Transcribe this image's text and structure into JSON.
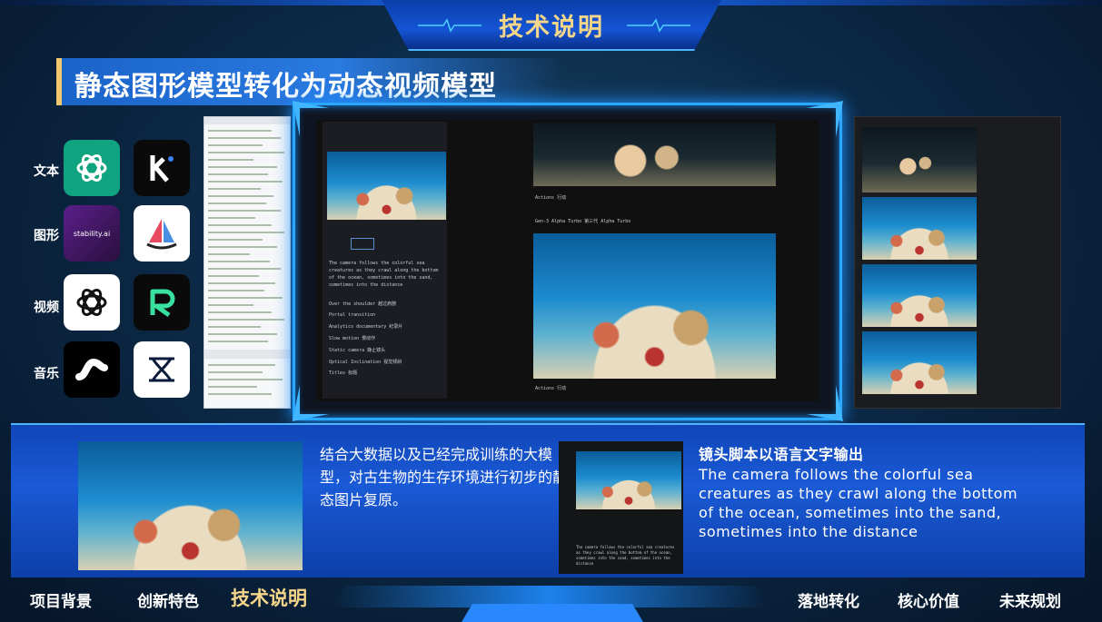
{
  "header": {
    "title": "技术说明",
    "subtitle": "静态图形模型转化为动态视频模型"
  },
  "categories": [
    {
      "label": "文本",
      "logos": [
        "openai-logo-icon",
        "kimi-logo-icon"
      ]
    },
    {
      "label": "图形",
      "logos": [
        "stability-ai-logo-icon",
        "sailboat-logo-icon"
      ]
    },
    {
      "label": "视频",
      "logos": [
        "openai-logo-icon",
        "runway-logo-icon"
      ]
    },
    {
      "label": "音乐",
      "logos": [
        "suno-logo-icon",
        "wave-logo-icon"
      ]
    }
  ],
  "logo_text": {
    "stability": "stability.ai"
  },
  "screen": {
    "sidebar_caption": "The camera follows the colorful sea creatures as they crawl along the bottom of the ocean, sometimes into the sand, sometimes into the distance",
    "options": [
      "Over the shoulder 越过肩膀",
      "Portal transition",
      "Analytics documentary 纪录片",
      "Slow motion 慢动作",
      "Static camera 静止镜头",
      "Optical Inclination 视觉倾斜",
      "Titles 标题"
    ],
    "actions_label": "Actions 行动",
    "model_label": "Gen-3 Alpha Turbo 第三代 Alpha Turbo"
  },
  "bottom": {
    "left_text": "结合大数据以及已经完成训练的大模型，对古生物的生存环境进行初步的静态图片复原。",
    "script_heading": "镜头脚本以语言文字输出",
    "script_english": "The camera follows the colorful sea creatures as they crawl along the bottom of the ocean, sometimes into the sand, sometimes into the distance",
    "mini_caption": "The camera follows the colorful sea creatures as they crawl along the bottom of the ocean, sometimes into the sand, sometimes into the distance"
  },
  "nav": {
    "items_left": [
      "项目背景",
      "创新特色"
    ],
    "active": "技术说明",
    "items_right": [
      "落地转化",
      "核心价值",
      "未来规划"
    ]
  },
  "colors": {
    "accent_gold": "#f5d58a",
    "accent_blue": "#2aa8ff",
    "panel_blue": "#1a5ad6"
  }
}
